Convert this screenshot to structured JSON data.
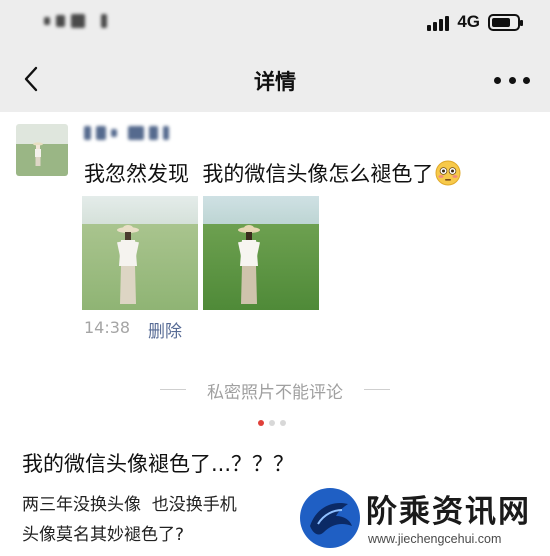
{
  "status_bar": {
    "network": "4G",
    "battery_level": 0.75
  },
  "nav": {
    "title": "详情",
    "back_icon": "chevron-left-icon",
    "more_icon": "ellipsis-icon"
  },
  "post": {
    "text": "我忽然发现  我的微信头像怎么褪色了",
    "emoji": "flushed-face-emoji",
    "time": "14:38",
    "delete_label": "删除",
    "photos": [
      {
        "subject": "woman-in-straw-hat-on-grassland",
        "tone": "faded"
      },
      {
        "subject": "woman-in-straw-hat-on-grassland",
        "tone": "vivid"
      }
    ],
    "private_note": "私密照片不能评论"
  },
  "pager": {
    "count": 3,
    "active_index": 0
  },
  "article": {
    "title": "我的微信头像褪色了...？？？",
    "lines": [
      "两三年没换头像  也没换手机",
      "头像莫名其妙褪色了?"
    ]
  },
  "watermark": {
    "title": "阶乘资讯网",
    "url": "www.jiechengcehui.com"
  },
  "colors": {
    "bar_bg": "#ededed",
    "link": "#576b95",
    "pager_active": "#e0403a",
    "muted": "#a5a5a5"
  }
}
